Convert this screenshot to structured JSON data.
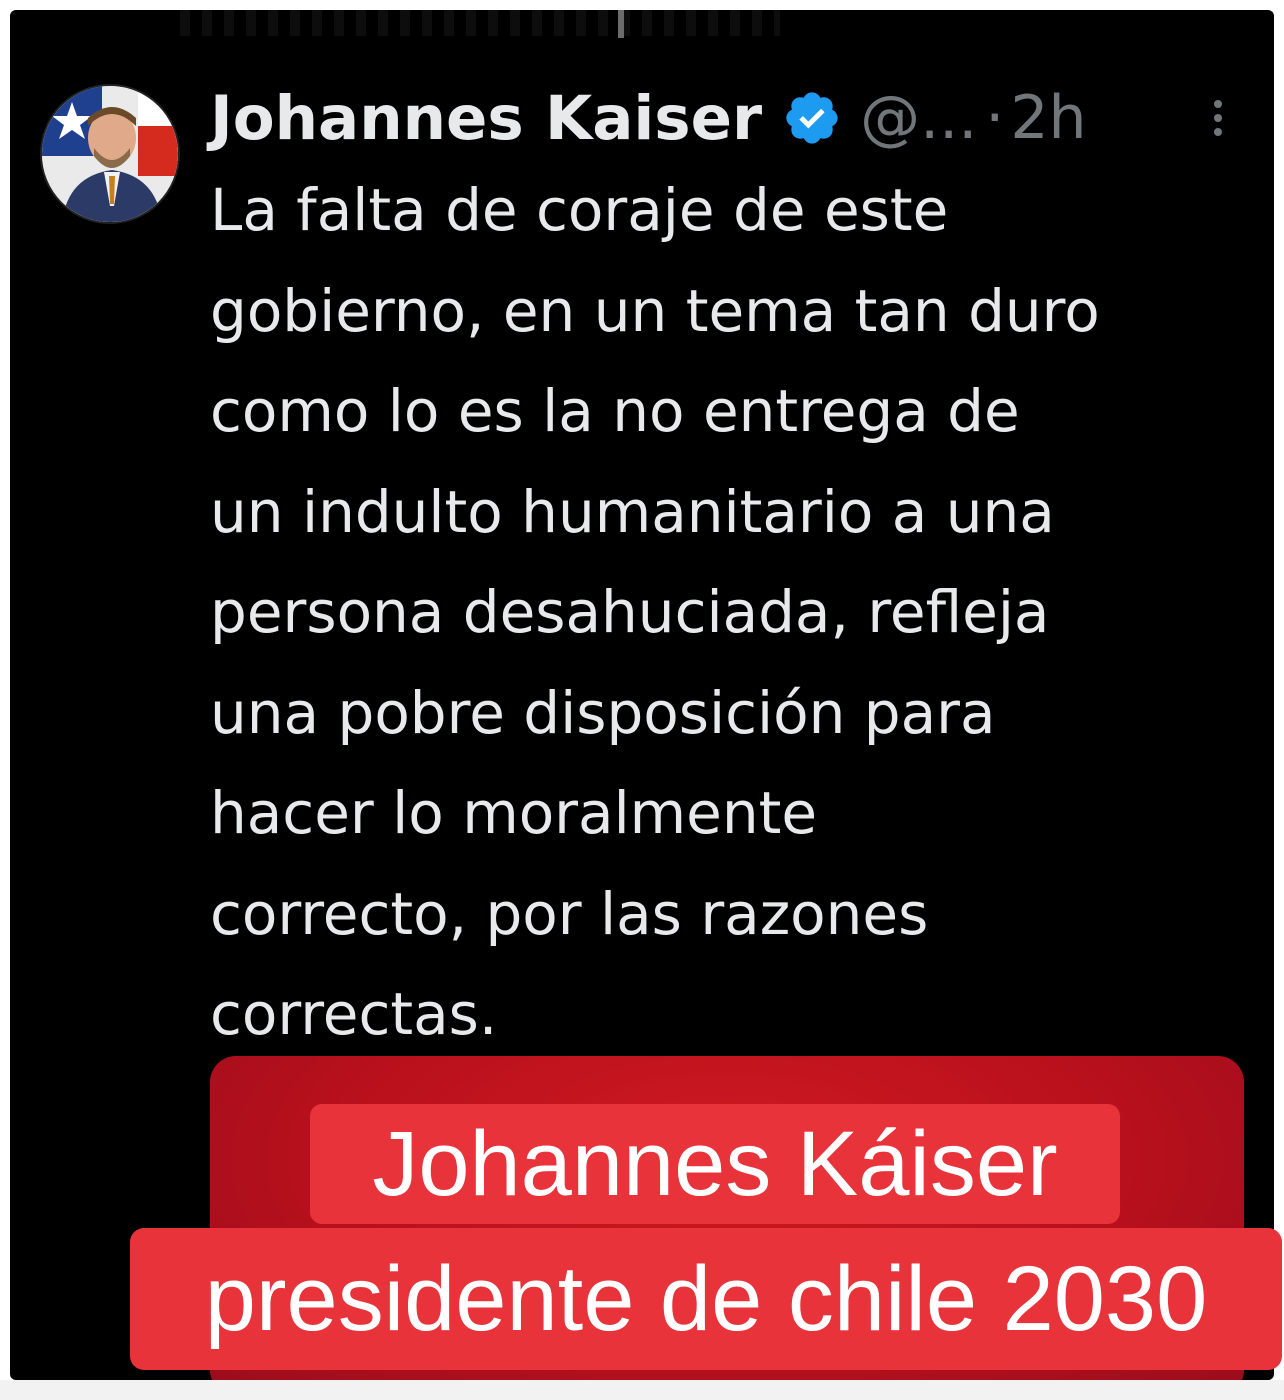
{
  "tweet": {
    "author_name": "Johannes Kaiser",
    "handle": "@...",
    "separator": "·",
    "time": "2h",
    "body": "La falta de coraje de este\ngobierno, en un tema tan duro\ncomo lo es la no entrega de\nun indulto humanitario a una\npersona desahuciada, refleja\nuna pobre disposición para\nhacer lo moralmente\ncorrecto, por las razones\ncorrectas.",
    "verified_badge_icon": "verified-check-icon",
    "more_icon": "vertical-ellipsis-icon"
  },
  "overlay": {
    "caption_line_1": "Johannes Káiser",
    "caption_line_2": "presidente de chile 2030"
  },
  "colors": {
    "background": "#000000",
    "text": "#e7e9ea",
    "muted": "#71767b",
    "verified": "#1d9bf0",
    "caption_bg": "#e8333b",
    "media_red": "#c8141e"
  }
}
